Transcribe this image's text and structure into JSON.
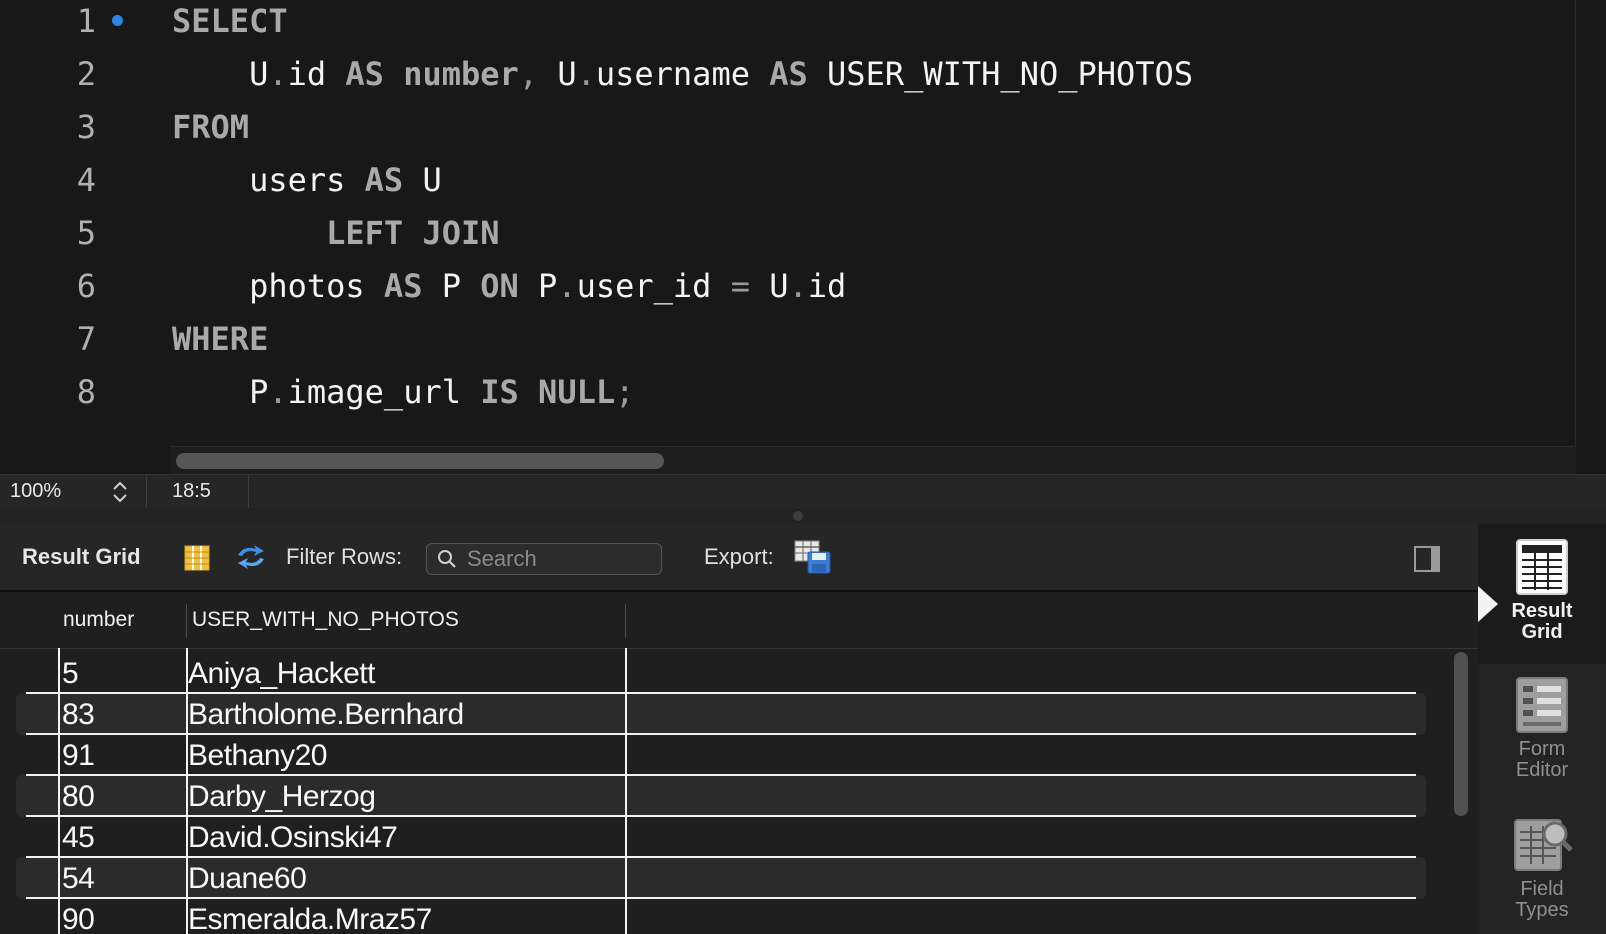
{
  "editor": {
    "line_numbers": [
      "1",
      "2",
      "3",
      "4",
      "5",
      "6",
      "7",
      "8"
    ],
    "lines": [
      [
        {
          "t": "SELECT",
          "c": "kw"
        }
      ],
      [
        {
          "t": "    ",
          "c": "id"
        },
        {
          "t": "U",
          "c": "id"
        },
        {
          "t": ".",
          "c": "op"
        },
        {
          "t": "id ",
          "c": "id"
        },
        {
          "t": "AS",
          "c": "kw"
        },
        {
          "t": " ",
          "c": "id"
        },
        {
          "t": "number",
          "c": "kw"
        },
        {
          "t": ", ",
          "c": "op"
        },
        {
          "t": "U",
          "c": "id"
        },
        {
          "t": ".",
          "c": "op"
        },
        {
          "t": "username ",
          "c": "id"
        },
        {
          "t": "AS",
          "c": "kw"
        },
        {
          "t": " USER_WITH_NO_PHOTOS",
          "c": "id"
        }
      ],
      [
        {
          "t": "FROM",
          "c": "kw"
        }
      ],
      [
        {
          "t": "    users ",
          "c": "id"
        },
        {
          "t": "AS",
          "c": "kw"
        },
        {
          "t": " U",
          "c": "id"
        }
      ],
      [
        {
          "t": "        ",
          "c": "id"
        },
        {
          "t": "LEFT JOIN",
          "c": "kw"
        }
      ],
      [
        {
          "t": "    photos ",
          "c": "id"
        },
        {
          "t": "AS",
          "c": "kw"
        },
        {
          "t": " P ",
          "c": "id"
        },
        {
          "t": "ON",
          "c": "kw"
        },
        {
          "t": " P",
          "c": "id"
        },
        {
          "t": ".",
          "c": "op"
        },
        {
          "t": "user_id ",
          "c": "id"
        },
        {
          "t": "=",
          "c": "op"
        },
        {
          "t": " U",
          "c": "id"
        },
        {
          "t": ".",
          "c": "op"
        },
        {
          "t": "id",
          "c": "id"
        }
      ],
      [
        {
          "t": "WHERE",
          "c": "kw"
        }
      ],
      [
        {
          "t": "    P",
          "c": "id"
        },
        {
          "t": ".",
          "c": "op"
        },
        {
          "t": "image_url ",
          "c": "id"
        },
        {
          "t": "IS NULL",
          "c": "kw"
        },
        {
          "t": ";",
          "c": "op"
        }
      ]
    ]
  },
  "statusbar": {
    "zoom": "100%",
    "cursor": "18:5"
  },
  "toolbar": {
    "title": "Result Grid",
    "filter_label": "Filter Rows:",
    "search_placeholder": "Search",
    "export_label": "Export:"
  },
  "grid": {
    "columns": [
      "number",
      "USER_WITH_NO_PHOTOS"
    ],
    "rows": [
      [
        "5",
        "Aniya_Hackett"
      ],
      [
        "83",
        "Bartholome.Bernhard"
      ],
      [
        "91",
        "Bethany20"
      ],
      [
        "80",
        "Darby_Herzog"
      ],
      [
        "45",
        "David.Osinski47"
      ],
      [
        "54",
        "Duane60"
      ],
      [
        "90",
        "Esmeralda.Mraz57"
      ]
    ]
  },
  "sidepanel": {
    "buttons": [
      {
        "label_1": "Result",
        "label_2": "Grid",
        "active": true,
        "icon": "result-grid-icon"
      },
      {
        "label_1": "Form",
        "label_2": "Editor",
        "active": false,
        "icon": "form-editor-icon"
      },
      {
        "label_1": "Field",
        "label_2": "Types",
        "active": false,
        "icon": "field-types-icon"
      }
    ]
  },
  "colors": {
    "background": "#181818",
    "keyword": "#a9a9a9",
    "marker": "#2a86e0"
  }
}
